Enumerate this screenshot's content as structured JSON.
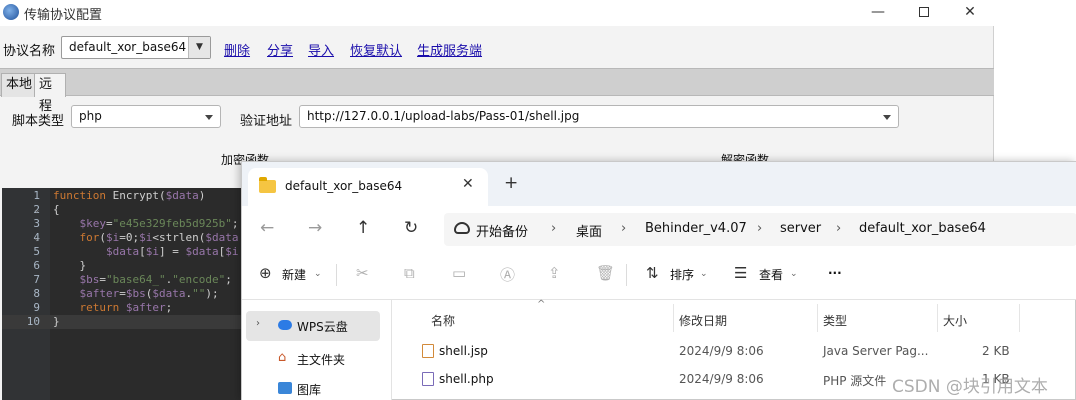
{
  "config_window": {
    "title": "传输协议配置",
    "protocol_label": "协议名称",
    "protocol_value": "default_xor_base64",
    "links": [
      "删除",
      "分享",
      "导入",
      "恢复默认",
      "生成服务端"
    ],
    "tabs": [
      "本地",
      "远程"
    ],
    "active_tab": "远程",
    "script_type_label": "脚本类型",
    "script_type_value": "php",
    "verify_addr_label": "验证地址",
    "verify_addr_value": "http://127.0.0.1/upload-labs/Pass-01/shell.jpg",
    "encrypt_label": "加密函数",
    "decrypt_label": "解密函数",
    "code_lines": [
      {
        "num": "1",
        "text": "function Encrypt($data)"
      },
      {
        "num": "2",
        "text": "{"
      },
      {
        "num": "3",
        "text": "    $key=\"e45e329feb5d925b\";"
      },
      {
        "num": "4",
        "text": "    for($i=0;$i<strlen($data"
      },
      {
        "num": "5",
        "text": "        $data[$i] = $data[$i"
      },
      {
        "num": "6",
        "text": "    }"
      },
      {
        "num": "7",
        "text": "    $bs=\"base64_\".\"encode\";"
      },
      {
        "num": "8",
        "text": "    $after=$bs($data.\"\");"
      },
      {
        "num": "9",
        "text": "    return $after;"
      },
      {
        "num": "10",
        "text": "}"
      }
    ]
  },
  "explorer": {
    "tab_title": "default_xor_base64",
    "breadcrumb": [
      "开始备份",
      "桌面",
      "Behinder_v4.07",
      "server",
      "default_xor_base64"
    ],
    "commands": {
      "new": "新建",
      "sort": "排序",
      "view": "查看",
      "more": "···"
    },
    "sidebar": [
      "WPS云盘",
      "主文件夹",
      "图库"
    ],
    "columns": [
      "名称",
      "修改日期",
      "类型",
      "大小"
    ],
    "files": [
      {
        "name": "shell.jsp",
        "modified": "2024/9/9 8:06",
        "type": "Java Server Pag...",
        "size": "2 KB"
      },
      {
        "name": "shell.php",
        "modified": "2024/9/9 8:06",
        "type": "PHP 源文件",
        "size": "1 KB"
      }
    ]
  },
  "watermark": "CSDN @块引用文本"
}
